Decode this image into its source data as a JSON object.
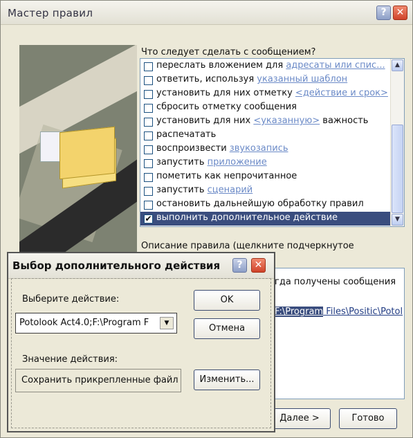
{
  "main_window": {
    "title": "Мастер правил",
    "help_glyph": "?",
    "close_glyph": "✕"
  },
  "actions_panel": {
    "question": "Что следует сделать с сообщением?",
    "items": [
      {
        "text": "переслать вложением для ",
        "link": "адресаты или спис...",
        "suffix": "",
        "checked": false
      },
      {
        "text": "ответить, используя ",
        "link": "указанный шаблон",
        "suffix": "",
        "checked": false
      },
      {
        "text": "установить для них отметку ",
        "link": "<действие и срок>",
        "suffix": "",
        "checked": false
      },
      {
        "text": "сбросить отметку сообщения",
        "link": "",
        "suffix": "",
        "checked": false
      },
      {
        "text": "установить для них ",
        "link": "<указанную>",
        "suffix": " важность",
        "checked": false
      },
      {
        "text": "распечатать",
        "link": "",
        "suffix": "",
        "checked": false
      },
      {
        "text": "воспроизвести ",
        "link": "звукозапись",
        "suffix": "",
        "checked": false
      },
      {
        "text": "запустить ",
        "link": "приложение",
        "suffix": "",
        "checked": false
      },
      {
        "text": "пометить как непрочитанное",
        "link": "",
        "suffix": "",
        "checked": false
      },
      {
        "text": "запустить ",
        "link": "сценарий",
        "suffix": "",
        "checked": false
      },
      {
        "text": "остановить дальнейшую обработку правил",
        "link": "",
        "suffix": "",
        "checked": false
      },
      {
        "text": "выполнить дополнительное действие",
        "link": "",
        "suffix": "",
        "checked": true
      }
    ],
    "check_glyph": "✔",
    "scroll_up": "▲",
    "scroll_down": "▼"
  },
  "description": {
    "label_line1": "Описание правила (щелкните подчеркнутое",
    "label_line2": "):",
    "line1": "гда получены сообщения",
    "line2_highlight": "F:\\Program",
    "line2_rest": " Files\\Positic\\Potol"
  },
  "buttons": {
    "next": "Далее >",
    "finish": "Готово"
  },
  "sub_dialog": {
    "title": "Выбор дополнительного действия",
    "help_glyph": "?",
    "close_glyph": "✕",
    "choose_label": "Выберите действие:",
    "combo_value": "Potolook Act4.0;F:\\Program F",
    "combo_arrow": "▼",
    "ok": "OK",
    "cancel": "Отмена",
    "value_label": "Значение действия:",
    "value_text": "Сохранить прикрепленные файлы",
    "change": "Изменить..."
  }
}
